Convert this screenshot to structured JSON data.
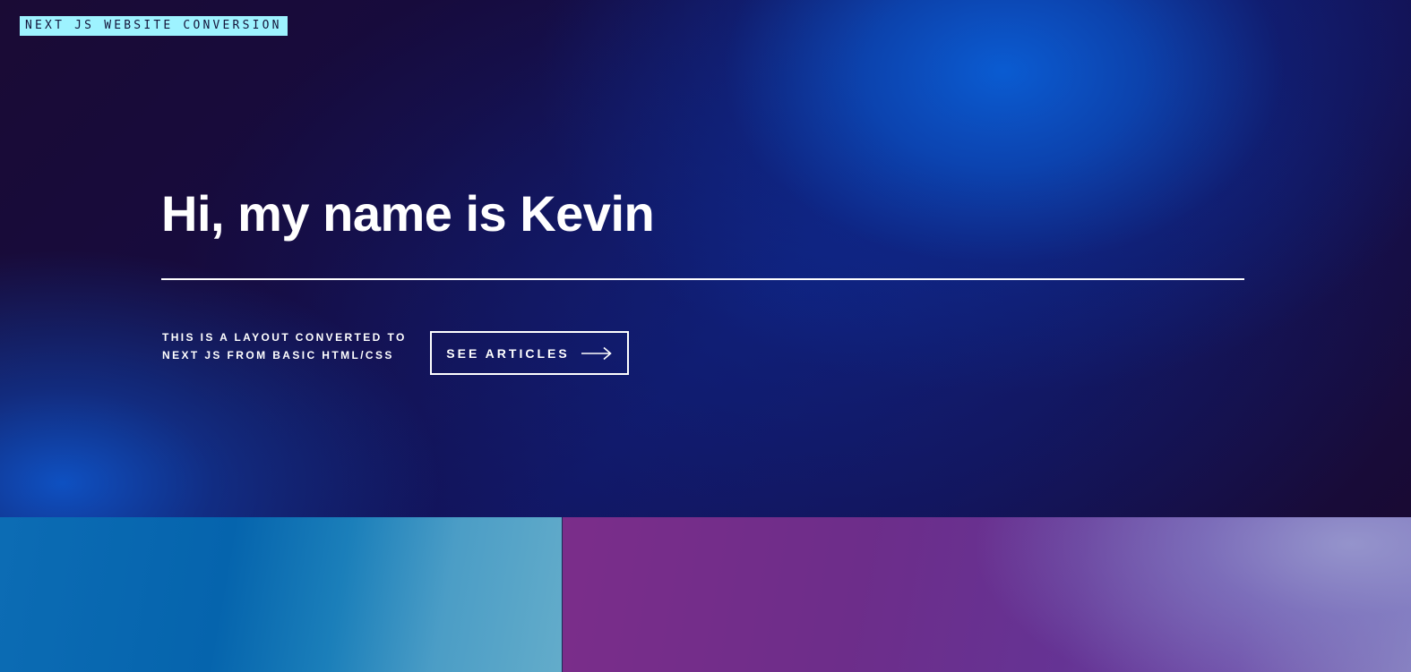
{
  "header": {
    "tag_label": "NEXT JS WEBSITE CONVERSION"
  },
  "hero": {
    "title": "Hi, my name is Kevin",
    "subtitle_line1": "THIS IS A LAYOUT CONVERTED TO",
    "subtitle_line2": "NEXT JS FROM BASIC HTML/CSS",
    "cta_label": "SEE ARTICLES",
    "cta_icon": "arrow-right-icon"
  },
  "tiles": [
    {
      "name": "blue-tile",
      "color": "#0564ad"
    },
    {
      "name": "purple-tile",
      "color": "#6d2d8a"
    }
  ],
  "colors": {
    "tag_background": "#9ef3ff",
    "hero_dark": "#160b3f",
    "hero_blue": "#0a5fd7",
    "text": "#ffffff"
  }
}
